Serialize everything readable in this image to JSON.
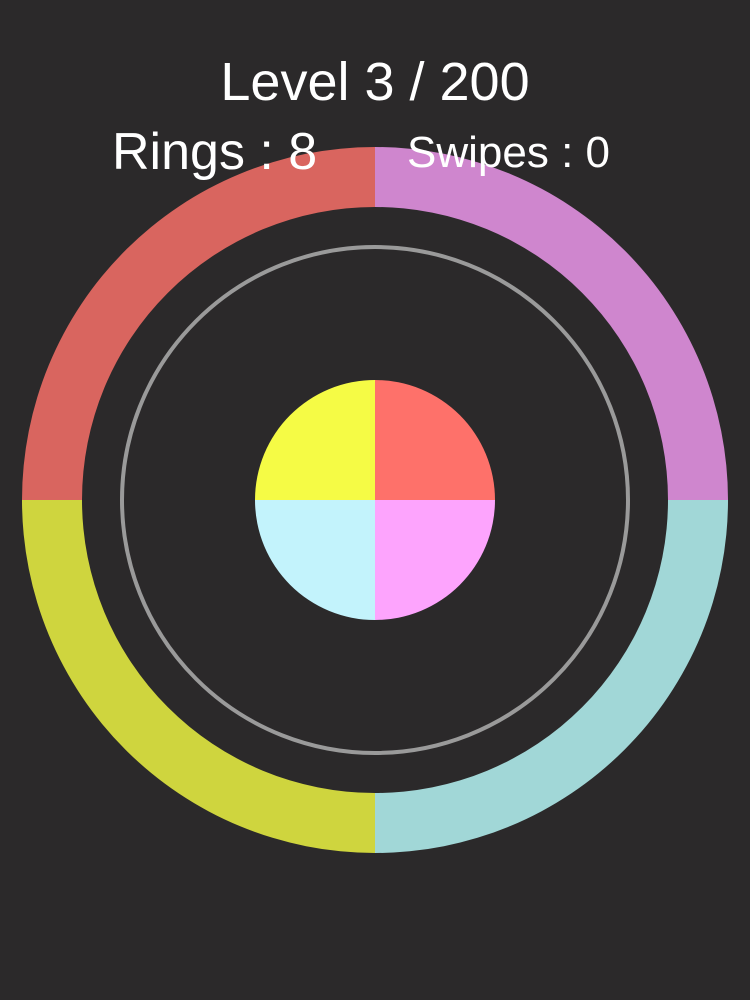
{
  "hud": {
    "level_text": "Level 3 / 200",
    "rings_text": "Rings : 8",
    "swipes_text": "Swipes : 0"
  },
  "game": {
    "level": 3,
    "total_levels": 200,
    "rings": 8,
    "swipes": 0
  },
  "colors": {
    "background": "#2b292a",
    "red": "#d9655f",
    "purple": "#cf86ce",
    "yellow": "#cfd53e",
    "cyan": "#a1d7d7",
    "center_yellow": "#f5fb45",
    "center_red": "#fe716a",
    "center_cyan": "#c3f3fc",
    "center_pink": "#fda4fd",
    "guide_ring": "#9a9a9a"
  }
}
